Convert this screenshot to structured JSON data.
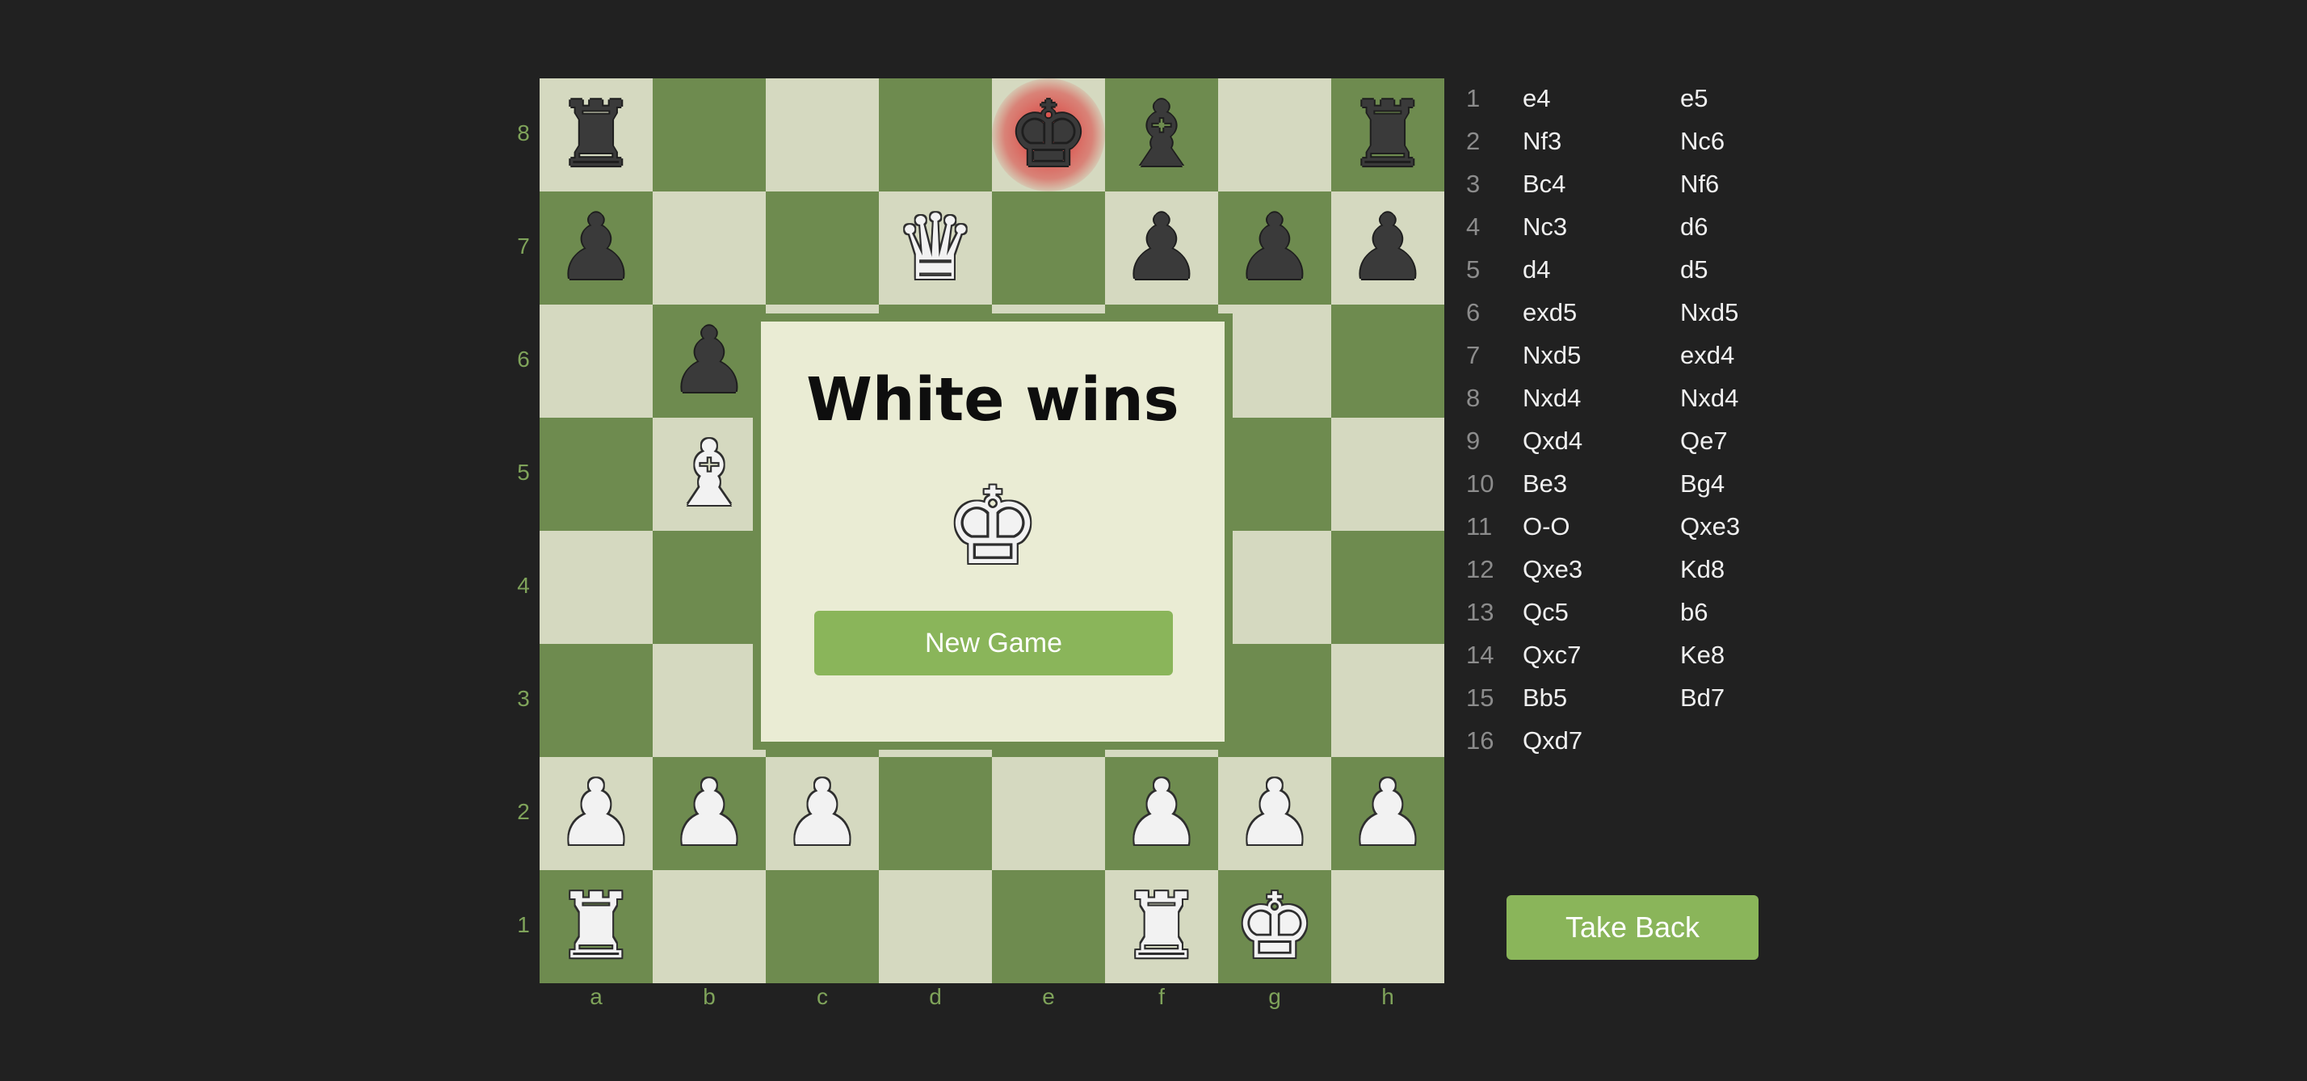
{
  "board": {
    "light_color": "#d5d9c0",
    "dark_color": "#6e8b4f",
    "ranks": [
      "8",
      "7",
      "6",
      "5",
      "4",
      "3",
      "2",
      "1"
    ],
    "files": [
      "a",
      "b",
      "c",
      "d",
      "e",
      "f",
      "g",
      "h"
    ],
    "pieces": [
      [
        "r",
        null,
        null,
        null,
        "k",
        "b",
        null,
        "r"
      ],
      [
        "p",
        null,
        null,
        "Q",
        null,
        "p",
        "p",
        "p"
      ],
      [
        null,
        "p",
        null,
        null,
        null,
        null,
        null,
        null
      ],
      [
        null,
        "B",
        null,
        null,
        null,
        null,
        null,
        null
      ],
      [
        null,
        null,
        null,
        null,
        null,
        null,
        null,
        null
      ],
      [
        null,
        null,
        null,
        null,
        null,
        null,
        null,
        null
      ],
      [
        "P",
        "P",
        "P",
        null,
        null,
        "P",
        "P",
        "P"
      ],
      [
        "R",
        null,
        null,
        null,
        null,
        "R",
        "K",
        null
      ]
    ],
    "in_check_square": "e8",
    "check_color": "#dc2828"
  },
  "piece_glyphs": {
    "K": "♚",
    "Q": "♛",
    "R": "♜",
    "B": "♝",
    "N": "♞",
    "P": "♟",
    "k": "♚",
    "q": "♛",
    "r": "♜",
    "b": "♝",
    "n": "♞",
    "p": "♟"
  },
  "result_dialog": {
    "title": "White wins",
    "winner_icon": "white-king-icon",
    "winner_glyph": "♚",
    "new_game_label": "New Game"
  },
  "moves": [
    {
      "no": "1",
      "white": "e4",
      "black": "e5"
    },
    {
      "no": "2",
      "white": "Nf3",
      "black": "Nc6"
    },
    {
      "no": "3",
      "white": "Bc4",
      "black": "Nf6"
    },
    {
      "no": "4",
      "white": "Nc3",
      "black": "d6"
    },
    {
      "no": "5",
      "white": "d4",
      "black": "d5"
    },
    {
      "no": "6",
      "white": "exd5",
      "black": "Nxd5"
    },
    {
      "no": "7",
      "white": "Nxd5",
      "black": "exd4"
    },
    {
      "no": "8",
      "white": "Nxd4",
      "black": "Nxd4"
    },
    {
      "no": "9",
      "white": "Qxd4",
      "black": "Qe7"
    },
    {
      "no": "10",
      "white": "Be3",
      "black": "Bg4"
    },
    {
      "no": "11",
      "white": "O-O",
      "black": "Qxe3"
    },
    {
      "no": "12",
      "white": "Qxe3",
      "black": "Kd8"
    },
    {
      "no": "13",
      "white": "Qc5",
      "black": "b6"
    },
    {
      "no": "14",
      "white": "Qxc7",
      "black": "Ke8"
    },
    {
      "no": "15",
      "white": "Bb5",
      "black": "Bd7"
    },
    {
      "no": "16",
      "white": "Qxd7",
      "black": ""
    }
  ],
  "controls": {
    "take_back_label": "Take Back",
    "button_color": "#8ab55a"
  }
}
